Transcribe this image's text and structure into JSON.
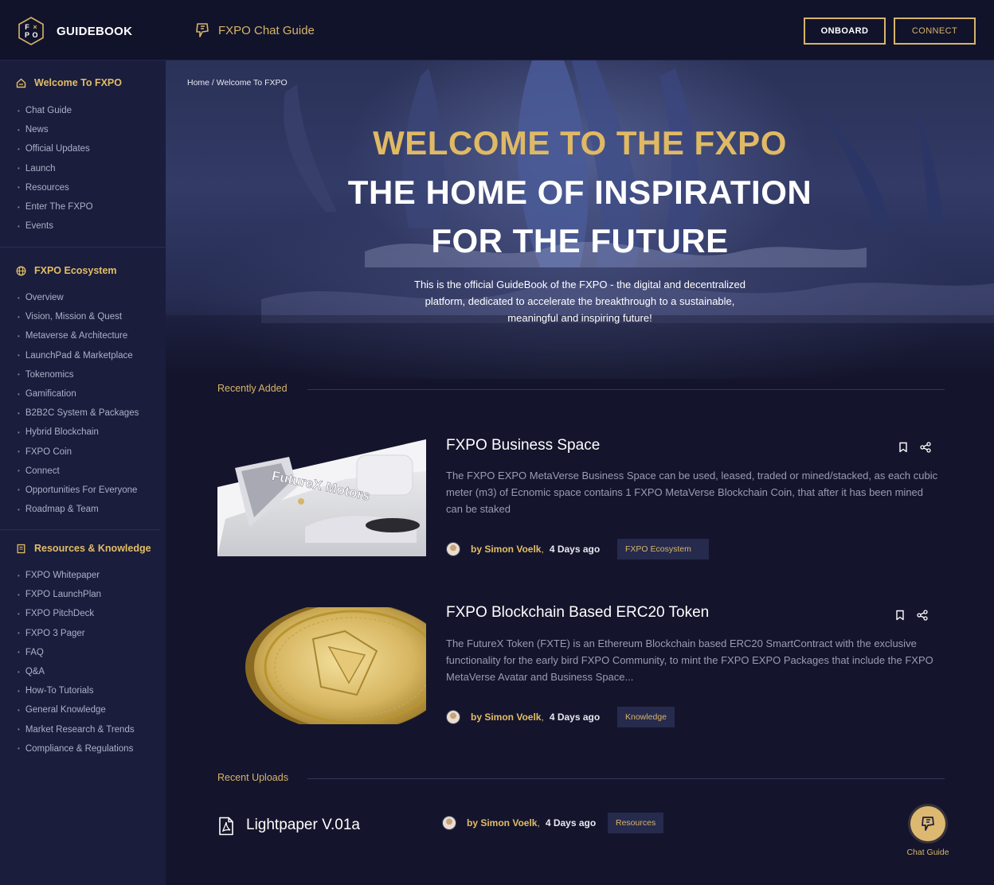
{
  "header": {
    "logo_letters": "FXPO",
    "brand": "GUIDEBOOK",
    "chat_guide": "FXPO Chat Guide",
    "onboard": "ONBOARD",
    "connect": "CONNECT"
  },
  "sidebar": {
    "sections": [
      {
        "title": "Welcome To FXPO",
        "icon": "home-icon",
        "items": [
          "Chat Guide",
          "News",
          "Official Updates",
          "Launch",
          "Resources",
          "Enter The FXPO",
          "Events"
        ]
      },
      {
        "title": "FXPO Ecosystem",
        "icon": "globe-icon",
        "items": [
          "Overview",
          "Vision, Mission & Quest",
          "Metaverse & Architecture",
          "LaunchPad & Marketplace",
          "Tokenomics",
          "Gamification",
          "B2B2C System & Packages",
          "Hybrid Blockchain",
          "FXPO Coin",
          "Connect",
          "Opportunities For Everyone",
          "Roadmap & Team"
        ]
      },
      {
        "title": "Resources & Knowledge",
        "icon": "book-icon",
        "items": [
          "FXPO Whitepaper",
          "FXPO LaunchPlan",
          "FXPO PitchDeck",
          "FXPO 3 Pager",
          "FAQ",
          "Q&A",
          "How-To Tutorials",
          "General Knowledge",
          "Market Research & Trends",
          "Compliance & Regulations"
        ]
      }
    ]
  },
  "hero": {
    "breadcrumb": "Home / Welcome To FXPO",
    "title_line1": "WELCOME TO THE FXPO",
    "title_line2": "THE HOME OF INSPIRATION",
    "title_line3": "FOR THE FUTURE",
    "description": "This is the official GuideBook of the FXPO - the digital and decentralized platform, dedicated to accelerate the breakthrough to a sustainable, meaningful and inspiring future!"
  },
  "recently_added": {
    "label": "Recently Added",
    "cards": [
      {
        "title": "FXPO Business Space",
        "description": "The FXPO EXPO MetaVerse Business Space can be used, leased, traded or mined/stacked, as each cubic meter (m3) of Ecnomic space contains 1 FXPO MetaVerse Blockchain Coin, that after it has been mined can be staked",
        "author": "by Simon Voelk",
        "time": "4 Days ago",
        "tag": "FXPO Ecosystem",
        "image_text": "FutureX Motors"
      },
      {
        "title": "FXPO Blockchain Based ERC20 Token",
        "description": "The FutureX Token (FXTE) is an Ethereum Blockchain based ERC20 SmartContract with the exclusive functionality for the early bird FXPO Community, to mint the FXPO EXPO Packages that include the FXPO MetaVerse Avatar and Business Space...",
        "author": "by Simon Voelk",
        "time": "4 Days ago",
        "tag": "Knowledge"
      }
    ]
  },
  "recent_uploads": {
    "label": "Recent Uploads",
    "items": [
      {
        "title": "Lightpaper V.01a",
        "author": "by Simon Voelk",
        "time": "4 Days ago",
        "tag": "Resources"
      }
    ]
  },
  "chat_fab": {
    "label": "Chat Guide"
  },
  "colors": {
    "accent_gold": "#d6b46a",
    "background": "#14152c",
    "sidebar": "#1a1d3c",
    "header": "#11132a"
  }
}
